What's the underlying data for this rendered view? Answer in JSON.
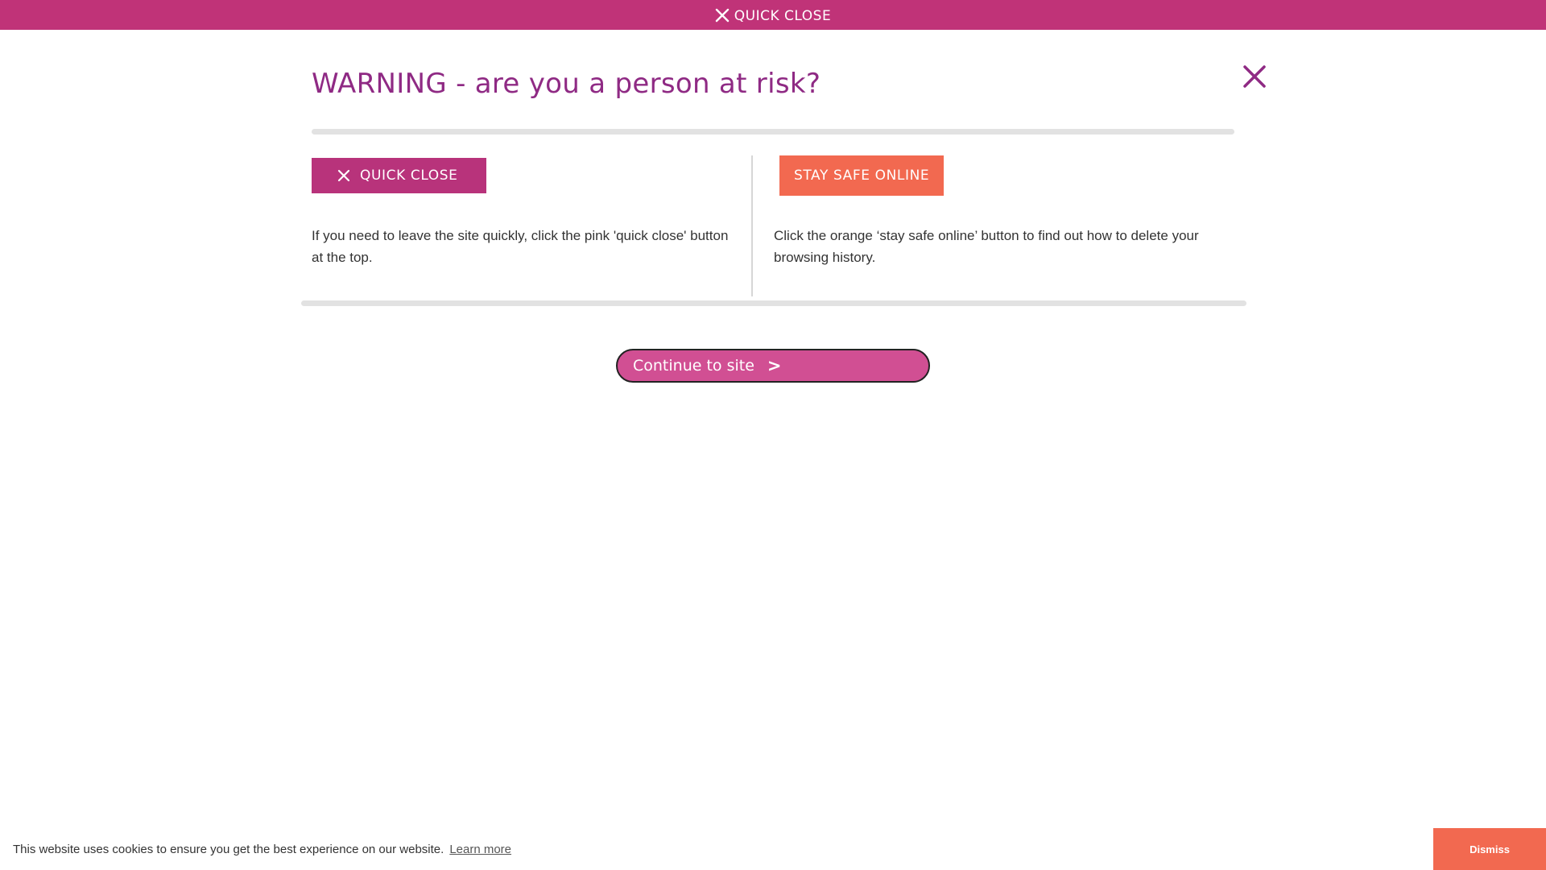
{
  "top_bar": {
    "quick_close_label": "QUICK CLOSE",
    "icon": "close-icon",
    "background": "#c03378"
  },
  "modal": {
    "title": "WARNING - are you a person at risk?",
    "close_icon": "close-icon",
    "left": {
      "button_label": "QUICK CLOSE",
      "button_icon": "close-icon",
      "description": "If you need to leave the site quickly, click the pink 'quick close' button at the top."
    },
    "right": {
      "button_label": "STAY SAFE ONLINE",
      "description": "Click the orange ‘stay safe online’ button to find out how to delete your browsing history."
    },
    "continue": {
      "label": "Continue to site",
      "chevron": ">"
    }
  },
  "cookie_banner": {
    "message": "This website uses cookies to ensure you get the best experience on our website.",
    "learn_more": "Learn more",
    "dismiss": "Dismiss"
  },
  "colors": {
    "brand_pink": "#c03378",
    "title_purple": "#8f2a84",
    "orange": "#f26950",
    "continue_pink": "#d14f93"
  }
}
